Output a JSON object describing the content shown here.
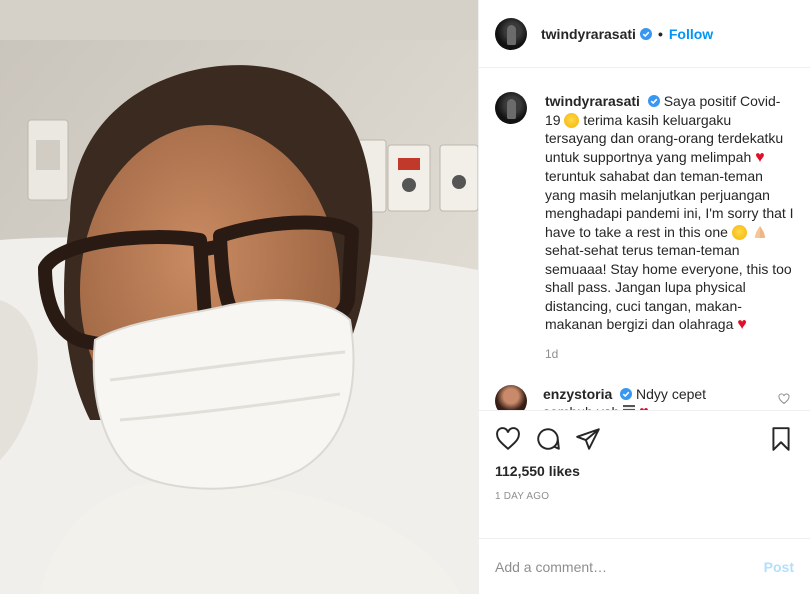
{
  "post": {
    "username": "twindyrarasati",
    "follow_label": "Follow",
    "caption_parts": {
      "p1": "Saya positif Covid-19",
      "p2": "terima kasih keluargaku tersayang dan orang-orang terdekatku untuk supportnya yang melimpah",
      "p3": "teruntuk sahabat dan teman-teman yang masih melanjutkan perjuangan menghadapi pandemi ini, I'm sorry that I have to take a rest in this one",
      "p4": "sehat-sehat terus teman-teman semuaaa! Stay home everyone, this too shall pass. Jangan lupa physical distancing, cuci tangan, makan-makanan bergizi dan olahraga"
    },
    "relative_time": "1d",
    "likes": "112,550 likes",
    "date": "1 DAY AGO"
  },
  "comment": {
    "username": "enzystoria",
    "text": "Ndyy cepet sembuh yah"
  },
  "add_comment": {
    "placeholder": "Add a comment…",
    "post_label": "Post"
  },
  "colors": {
    "accent": "#0095f6",
    "verified": "#3897f0",
    "heart": "#e0102a"
  },
  "icons": [
    "verified-icon",
    "heart-outline-icon",
    "comment-icon",
    "share-icon",
    "bookmark-icon",
    "smile-emoji",
    "heart-emoji",
    "pray-emoji"
  ]
}
